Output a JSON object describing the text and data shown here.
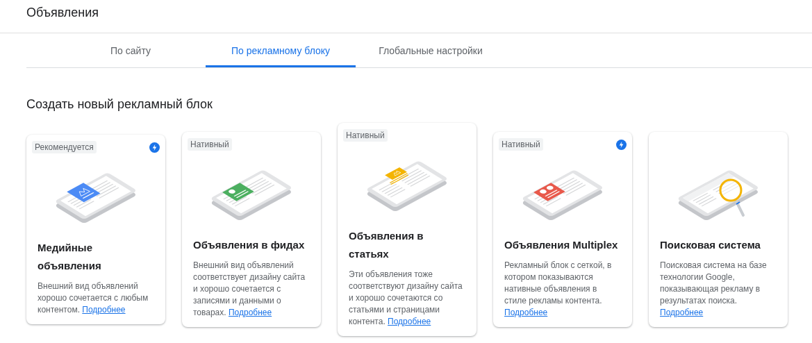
{
  "header": {
    "title": "Объявления"
  },
  "tabs": [
    {
      "label": "По сайту",
      "selected": false
    },
    {
      "label": "По рекламному блоку",
      "selected": true
    },
    {
      "label": "Глобальные настройки",
      "selected": false
    }
  ],
  "section_title": "Создать новый рекламный блок",
  "cards": [
    {
      "kind": "display",
      "badge": "Рекомендуется",
      "fast": true,
      "title": "Медийные объявления",
      "description": "Внешний вид объявлений хорошо сочетается с любым контентом.",
      "link": "Подробнее"
    },
    {
      "kind": "feed",
      "badge": "Нативный",
      "fast": false,
      "title": "Объявления в фидах",
      "description": "Внешний вид объявлений соответствует дизайну сайта и хорошо сочетается с записями и данными о товарах.",
      "link": "Подробнее"
    },
    {
      "kind": "article",
      "badge": "Нативный",
      "fast": false,
      "title": "Объявления в статьях",
      "description": "Эти объявления тоже соответствуют дизайну сайта и хорошо сочетаются со статьями и страницами контента.",
      "link": "Подробнее"
    },
    {
      "kind": "multiplex",
      "badge": "Нативный",
      "fast": true,
      "title": "Объявления Multiplex",
      "description": "Рекламный блок с сеткой, в котором показываются нативные объявления в стиле рекламы контента.",
      "link": "Подробнее"
    },
    {
      "kind": "search",
      "fast": false,
      "title": "Поисковая система",
      "description": "Поисковая система на базе технологии Google, показывающая рекламу в результатах поиска.",
      "link": "Подробнее"
    }
  ]
}
